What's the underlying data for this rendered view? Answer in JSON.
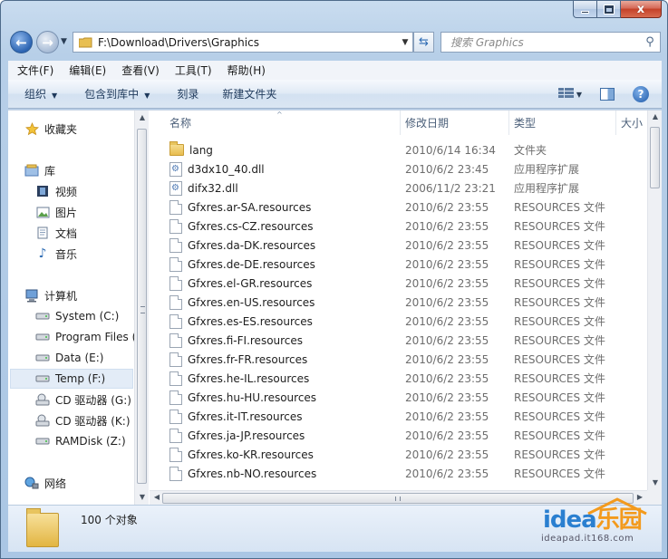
{
  "window": {
    "min_label": "",
    "max_label": "",
    "close_label": "x"
  },
  "address": {
    "path": "F:\\Download\\Drivers\\Graphics",
    "search_placeholder": "搜索 Graphics"
  },
  "menu": [
    "文件(F)",
    "编辑(E)",
    "查看(V)",
    "工具(T)",
    "帮助(H)"
  ],
  "toolbar": {
    "organize": "组织",
    "include_library": "包含到库中",
    "burn": "刻录",
    "new_folder": "新建文件夹"
  },
  "navpane": {
    "favorites": "收藏夹",
    "libraries": "库",
    "videos": "视频",
    "pictures": "图片",
    "documents": "文档",
    "music": "音乐",
    "computer": "计算机",
    "drives": [
      "System (C:)",
      "Program Files (",
      "Data (E:)",
      "Temp (F:)",
      "CD 驱动器 (G:)",
      "CD 驱动器 (K:)",
      "RAMDisk (Z:)"
    ],
    "network": "网络"
  },
  "columns": {
    "name": "名称",
    "date": "修改日期",
    "type": "类型",
    "size": "大小"
  },
  "files": [
    {
      "name": "lang",
      "date": "2010/6/14 16:34",
      "type": "文件夹",
      "icon": "folder"
    },
    {
      "name": "d3dx10_40.dll",
      "date": "2010/6/2 23:45",
      "type": "应用程序扩展",
      "icon": "dll"
    },
    {
      "name": "difx32.dll",
      "date": "2006/11/2 23:21",
      "type": "应用程序扩展",
      "icon": "dll"
    },
    {
      "name": "Gfxres.ar-SA.resources",
      "date": "2010/6/2 23:55",
      "type": "RESOURCES 文件",
      "icon": "doc"
    },
    {
      "name": "Gfxres.cs-CZ.resources",
      "date": "2010/6/2 23:55",
      "type": "RESOURCES 文件",
      "icon": "doc"
    },
    {
      "name": "Gfxres.da-DK.resources",
      "date": "2010/6/2 23:55",
      "type": "RESOURCES 文件",
      "icon": "doc"
    },
    {
      "name": "Gfxres.de-DE.resources",
      "date": "2010/6/2 23:55",
      "type": "RESOURCES 文件",
      "icon": "doc"
    },
    {
      "name": "Gfxres.el-GR.resources",
      "date": "2010/6/2 23:55",
      "type": "RESOURCES 文件",
      "icon": "doc"
    },
    {
      "name": "Gfxres.en-US.resources",
      "date": "2010/6/2 23:55",
      "type": "RESOURCES 文件",
      "icon": "doc"
    },
    {
      "name": "Gfxres.es-ES.resources",
      "date": "2010/6/2 23:55",
      "type": "RESOURCES 文件",
      "icon": "doc"
    },
    {
      "name": "Gfxres.fi-FI.resources",
      "date": "2010/6/2 23:55",
      "type": "RESOURCES 文件",
      "icon": "doc"
    },
    {
      "name": "Gfxres.fr-FR.resources",
      "date": "2010/6/2 23:55",
      "type": "RESOURCES 文件",
      "icon": "doc"
    },
    {
      "name": "Gfxres.he-IL.resources",
      "date": "2010/6/2 23:55",
      "type": "RESOURCES 文件",
      "icon": "doc"
    },
    {
      "name": "Gfxres.hu-HU.resources",
      "date": "2010/6/2 23:55",
      "type": "RESOURCES 文件",
      "icon": "doc"
    },
    {
      "name": "Gfxres.it-IT.resources",
      "date": "2010/6/2 23:55",
      "type": "RESOURCES 文件",
      "icon": "doc"
    },
    {
      "name": "Gfxres.ja-JP.resources",
      "date": "2010/6/2 23:55",
      "type": "RESOURCES 文件",
      "icon": "doc"
    },
    {
      "name": "Gfxres.ko-KR.resources",
      "date": "2010/6/2 23:55",
      "type": "RESOURCES 文件",
      "icon": "doc"
    },
    {
      "name": "Gfxres.nb-NO.resources",
      "date": "2010/6/2 23:55",
      "type": "RESOURCES 文件",
      "icon": "doc"
    }
  ],
  "status": {
    "count": "100 个对象"
  },
  "watermark": {
    "brand": "idea乐园",
    "url": "ideapad.it168.com"
  },
  "colors": {
    "accent": "#2c64b2",
    "brand_orange": "#f39a1d",
    "brand_blue": "#2a7fd0"
  }
}
